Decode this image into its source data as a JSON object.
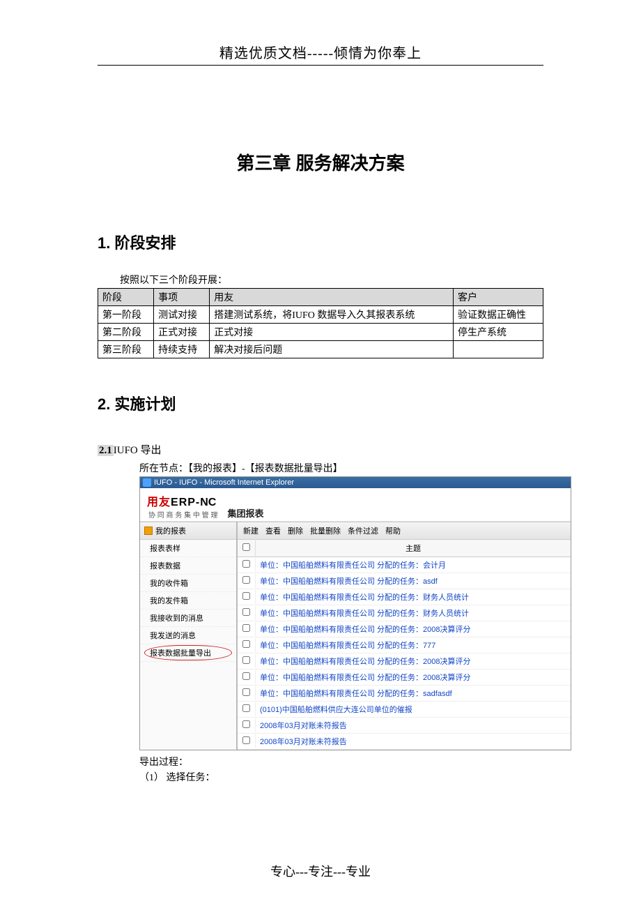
{
  "header": "精选优质文档-----倾情为你奉上",
  "chapter_title": "第三章  服务解决方案",
  "section1": {
    "title": "1.  阶段安排",
    "intro": "按照以下三个阶段开展：",
    "table": {
      "headers": [
        "阶段",
        "事项",
        "用友",
        "客户"
      ],
      "rows": [
        [
          "第一阶段",
          "测试对接",
          "搭建测试系统，将IUFO 数据导入久其报表系统",
          "验证数据正确性"
        ],
        [
          "第二阶段",
          "正式对接",
          "正式对接",
          "停生产系统"
        ],
        [
          "第三阶段",
          "持续支持",
          "解决对接后问题",
          ""
        ]
      ]
    }
  },
  "section2": {
    "title": "2.  实施计划",
    "sub": {
      "num": "2.1",
      "text": "IUFO 导出"
    },
    "node_line": "所在节点：【我的报表】-【报表数据批量导出】",
    "after": {
      "line1": "导出过程：",
      "line2": "（1）  选择任务："
    }
  },
  "screenshot": {
    "titlebar": "IUFO - IUFO - Microsoft Internet Explorer",
    "logo": {
      "brand": "用友",
      "erp": "ERP-",
      "nc": "NC",
      "sub": "协 同 商 务   集 中 管 理",
      "prod": "集团报表"
    },
    "nav_header": "我的报表",
    "nav_items": [
      {
        "label": "报表表样",
        "active": false
      },
      {
        "label": "报表数据",
        "active": false
      },
      {
        "label": "我的收件箱",
        "active": false
      },
      {
        "label": "我的发件箱",
        "active": false
      },
      {
        "label": "我接收到的消息",
        "active": false
      },
      {
        "label": "我发送的消息",
        "active": false
      },
      {
        "label": "报表数据批量导出",
        "active": true
      }
    ],
    "toolbar": [
      "新建",
      "查看",
      "删除",
      "批量删除",
      "条件过滤",
      "帮助"
    ],
    "grid": {
      "subject_header": "主题",
      "rows": [
        "单位：中国船舶燃料有限责任公司  分配的任务：会计月",
        "单位：中国船舶燃料有限责任公司  分配的任务：asdf",
        "单位：中国船舶燃料有限责任公司  分配的任务：财务人员统计",
        "单位：中国船舶燃料有限责任公司  分配的任务：财务人员统计",
        "单位：中国船舶燃料有限责任公司  分配的任务：2008决算评分",
        "单位：中国船舶燃料有限责任公司  分配的任务：777",
        "单位：中国船舶燃料有限责任公司  分配的任务：2008决算评分",
        "单位：中国船舶燃料有限责任公司  分配的任务：2008决算评分",
        "单位：中国船舶燃料有限责任公司  分配的任务：sadfasdf",
        "(0101)中国船舶燃料供应大连公司单位的催报",
        "2008年03月对账未符报告",
        "2008年03月对账未符报告"
      ]
    }
  },
  "footer": "专心---专注---专业"
}
